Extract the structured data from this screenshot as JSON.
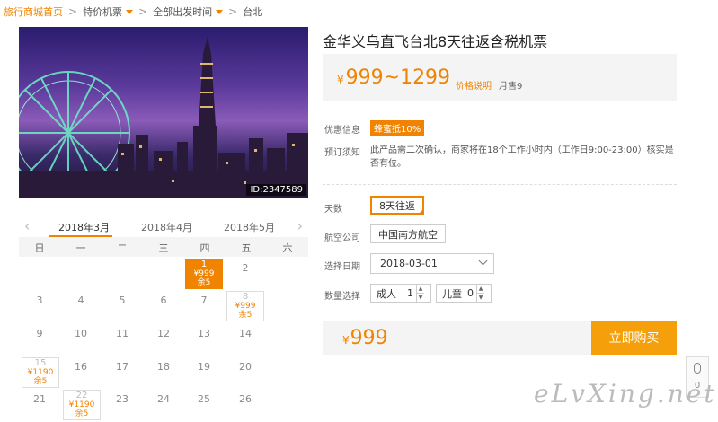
{
  "breadcrumb": {
    "home": "旅行商城首页",
    "items": [
      "特价机票",
      "全部出发时间",
      "台北"
    ]
  },
  "hero": {
    "id_tag": "ID:2347589"
  },
  "calendar": {
    "months": [
      "2018年3月",
      "2018年4月",
      "2018年5月"
    ],
    "active_month": "2018年3月",
    "weekdays": [
      "日",
      "一",
      "二",
      "三",
      "四",
      "五",
      "六"
    ],
    "days": [
      {
        "d": "2",
        "price": "",
        "left": ""
      },
      {
        "d": "3",
        "price": "",
        "left": ""
      },
      {
        "d": "4",
        "price": "",
        "left": ""
      },
      {
        "d": "5",
        "price": "",
        "left": ""
      },
      {
        "d": "6",
        "price": "",
        "left": ""
      },
      {
        "d": "7",
        "price": "",
        "left": ""
      },
      {
        "d": "9",
        "price": "",
        "left": ""
      },
      {
        "d": "10",
        "price": "",
        "left": ""
      },
      {
        "d": "11",
        "price": "",
        "left": ""
      },
      {
        "d": "12",
        "price": "",
        "left": ""
      },
      {
        "d": "13",
        "price": "",
        "left": ""
      },
      {
        "d": "14",
        "price": "",
        "left": ""
      },
      {
        "d": "16",
        "price": "",
        "left": ""
      },
      {
        "d": "17",
        "price": "",
        "left": ""
      },
      {
        "d": "18",
        "price": "",
        "left": ""
      },
      {
        "d": "19",
        "price": "",
        "left": ""
      },
      {
        "d": "20",
        "price": "",
        "left": ""
      },
      {
        "d": "21",
        "price": "",
        "left": ""
      },
      {
        "d": "23",
        "price": "",
        "left": ""
      },
      {
        "d": "24",
        "price": "",
        "left": ""
      },
      {
        "d": "25",
        "price": "",
        "left": ""
      },
      {
        "d": "26",
        "price": "",
        "left": ""
      }
    ],
    "price_days": [
      {
        "d": "1",
        "price": "¥999",
        "left": "余5",
        "selected": true
      },
      {
        "d": "8",
        "price": "¥999",
        "left": "余5",
        "selected": false
      },
      {
        "d": "15",
        "price": "¥1190",
        "left": "余5",
        "selected": false
      },
      {
        "d": "22",
        "price": "¥1190",
        "left": "余5",
        "selected": false
      }
    ]
  },
  "product": {
    "title": "金华义乌直飞台北8天往返含税机票",
    "price_yen": "¥",
    "price_range": "999~1299",
    "price_explain": "价格说明",
    "sold": "月售9",
    "promo_label": "优惠信息",
    "promo_badge": "蜂蜜抵10%",
    "notice_label": "预订须知",
    "notice_text": "此产品需二次确认，商家将在18个工作小时内（工作日9:00-23:00）核实是否有位。",
    "days_label": "天数",
    "days_value": "8天往返",
    "airline_label": "航空公司",
    "airline_value": "中国南方航空",
    "date_label": "选择日期",
    "date_value": "2018-03-01",
    "qty_label": "数量选择",
    "adult_label": "成人",
    "adult_value": "1",
    "child_label": "儿童",
    "child_value": "0",
    "total_yen": "¥",
    "total": "999",
    "buy_label": "立即购买"
  },
  "side": {
    "count": "0"
  },
  "watermark": "eLvXing.net",
  "colors": {
    "accent": "#f08300",
    "buy": "#f5a00a"
  }
}
